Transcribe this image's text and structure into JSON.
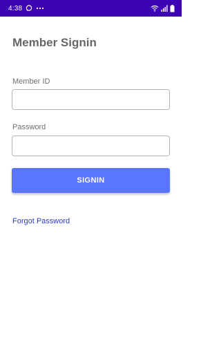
{
  "status_bar": {
    "time": "4:38",
    "background": "#3d03b4",
    "icons": [
      "chat-bubble-icon",
      "more-dots-icon",
      "wifi-icon",
      "signal-icon",
      "battery-icon"
    ]
  },
  "screen": {
    "title": "Member Signin"
  },
  "form": {
    "member_id_label": "Member ID",
    "member_id_value": "",
    "password_label": "Password",
    "password_value": "",
    "signin_label": "SIGNIN",
    "accent_color": "#5a75ff"
  },
  "links": {
    "forgot_password": "Forgot Password",
    "color": "#2a3dc8"
  }
}
